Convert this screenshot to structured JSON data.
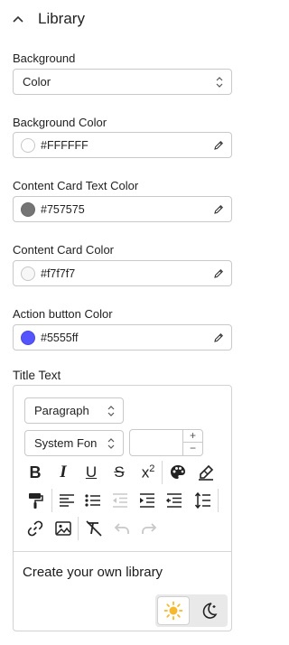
{
  "section": {
    "title": "Library"
  },
  "fields": {
    "background": {
      "label": "Background",
      "value": "Color"
    },
    "background_color": {
      "label": "Background Color",
      "value": "#FFFFFF",
      "swatch": "#FFFFFF"
    },
    "content_card_text_color": {
      "label": "Content Card Text Color",
      "value": "#757575",
      "swatch": "#757575"
    },
    "content_card_color": {
      "label": "Content Card Color",
      "value": "#f7f7f7",
      "swatch": "#f7f7f7"
    },
    "action_button_color": {
      "label": "Action button Color",
      "value": "#5555ff",
      "swatch": "#5555ff"
    }
  },
  "title_text": {
    "label": "Title Text",
    "block_style": "Paragraph",
    "font_family": "System Fon",
    "font_size": "",
    "content": "Create your own library"
  },
  "toolbar_icons": [
    "bold-icon",
    "italic-icon",
    "underline-icon",
    "strikethrough-icon",
    "superscript-icon",
    "palette-icon",
    "highlight-icon",
    "paint-roller-icon",
    "align-left-icon",
    "bulleted-list-icon",
    "outdent-icon",
    "indent-icon",
    "left-to-right-icon",
    "line-height-icon",
    "link-icon",
    "image-icon",
    "clear-format-icon",
    "undo-icon",
    "redo-icon"
  ],
  "theme": {
    "active": "light",
    "options": [
      "sun-icon",
      "moon-icon"
    ]
  }
}
